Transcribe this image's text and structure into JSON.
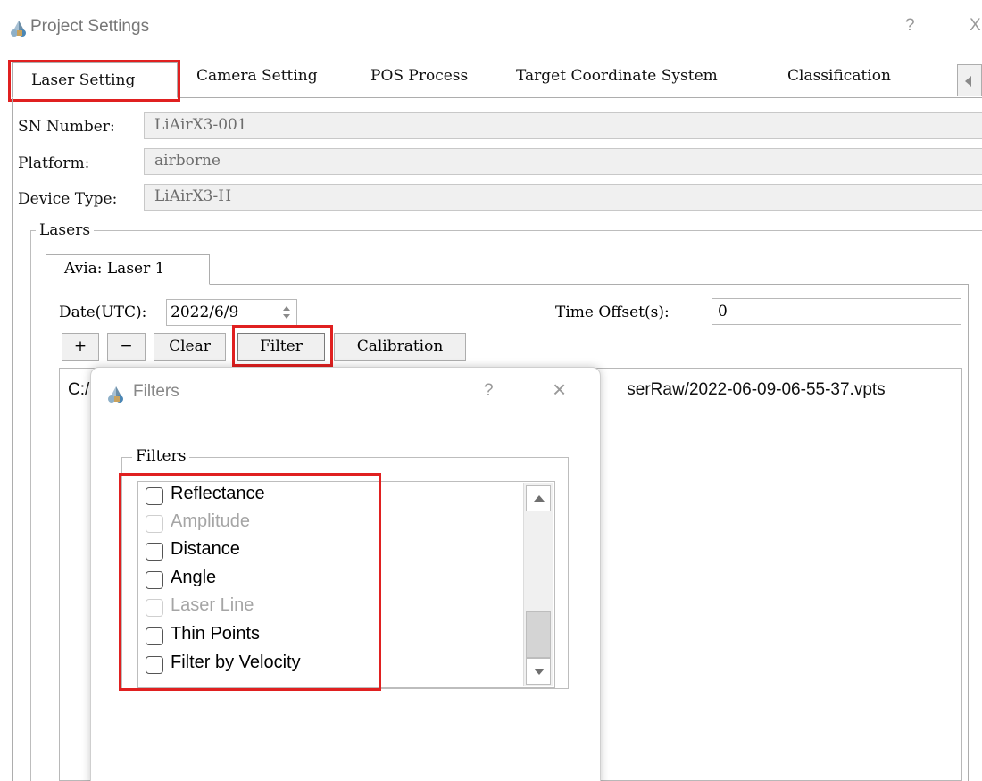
{
  "window": {
    "title": "Project Settings",
    "help": "?",
    "close": "X"
  },
  "tabs": [
    "Laser Setting",
    "Camera Setting",
    "POS Process",
    "Target Coordinate System",
    "Classification"
  ],
  "fields": {
    "sn_label": "SN Number:",
    "sn_value": "LiAirX3-001",
    "platform_label": "Platform:",
    "platform_value": "airborne",
    "device_label": "Device Type:",
    "device_value": "LiAirX3-H"
  },
  "lasers": {
    "group_title": "Lasers",
    "inner_tab": "Avia: Laser 1",
    "date_label": "Date(UTC):",
    "date_value": "2022/6/9",
    "offset_label": "Time Offset(s):",
    "offset_value": "0",
    "buttons": {
      "plus": "+",
      "minus": "−",
      "clear": "Clear",
      "filter": "Filter",
      "calibration": "Calibration"
    },
    "file_path_start": "C:/",
    "file_path_end": "serRaw/2022-06-09-06-55-37.vpts"
  },
  "filters_dialog": {
    "title": "Filters",
    "help": "?",
    "close": "×",
    "group_title": "Filters",
    "items": [
      {
        "label": "Reflectance",
        "checked": false,
        "enabled": true
      },
      {
        "label": "Amplitude",
        "checked": false,
        "enabled": false
      },
      {
        "label": "Distance",
        "checked": false,
        "enabled": true
      },
      {
        "label": "Angle",
        "checked": false,
        "enabled": true
      },
      {
        "label": "Laser Line",
        "checked": false,
        "enabled": false
      },
      {
        "label": "Thin Points",
        "checked": false,
        "enabled": true
      },
      {
        "label": "Filter by Velocity",
        "checked": false,
        "enabled": true
      }
    ]
  },
  "icons": {
    "app": "app-logo-icon",
    "tab_scroll": "chevron-left-icon"
  },
  "colors": {
    "highlight": "#e02020",
    "disabled_text": "#a5a5a5"
  }
}
